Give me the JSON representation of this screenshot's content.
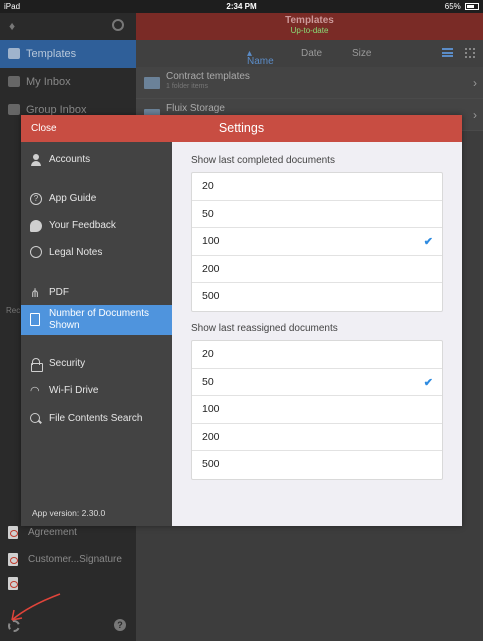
{
  "status_bar": {
    "device": "iPad",
    "time": "2:34 PM",
    "battery": "65%"
  },
  "bg_sidebar": {
    "nav": [
      {
        "label": "Templates",
        "active": true
      },
      {
        "label": "My Inbox",
        "active": false
      },
      {
        "label": "Group Inbox",
        "active": false
      }
    ],
    "recent_label": "Rec",
    "bottom_items": [
      "Agreement",
      "Customer...Signature"
    ]
  },
  "bg_main": {
    "title": "Templates",
    "subtitle": "Up-to-date",
    "sort_tabs": [
      "Name",
      "Date",
      "Size"
    ],
    "rows": [
      {
        "title": "Contract templates",
        "sub": "1 folder items"
      },
      {
        "title": "Fluix Storage",
        "sub": ""
      }
    ]
  },
  "settings": {
    "close_label": "Close",
    "title": "Settings",
    "menu": [
      {
        "label": "Accounts",
        "icon": "person-icon"
      },
      {
        "label": "App Guide",
        "icon": "question-icon"
      },
      {
        "label": "Your Feedback",
        "icon": "speech-bubble-icon"
      },
      {
        "label": "Legal Notes",
        "icon": "badge-icon"
      },
      {
        "label": "PDF",
        "icon": "share-nodes-icon"
      },
      {
        "label": "Number of Documents Shown",
        "icon": "document-icon",
        "selected": true
      },
      {
        "label": "Security",
        "icon": "lock-icon"
      },
      {
        "label": "Wi-Fi Drive",
        "icon": "wifi-icon"
      },
      {
        "label": "File Contents Search",
        "icon": "search-icon"
      }
    ],
    "version_label": "App version:",
    "version_value": "2.30.0",
    "completed": {
      "label": "Show last completed documents",
      "options": [
        "20",
        "50",
        "100",
        "200",
        "500"
      ],
      "selected": "100"
    },
    "reassigned": {
      "label": "Show last reassigned documents",
      "options": [
        "20",
        "50",
        "100",
        "200",
        "500"
      ],
      "selected": "50"
    }
  },
  "colors": {
    "header_red": "#c84d42",
    "selection_blue": "#4f94dd",
    "check_blue": "#2f8be0"
  }
}
